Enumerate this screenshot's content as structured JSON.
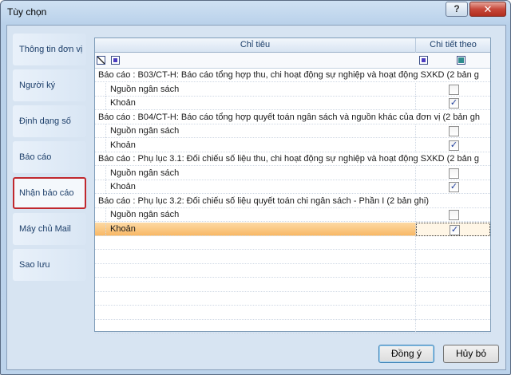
{
  "window": {
    "title": "Tùy chọn",
    "help_label": "?",
    "close_label": "✕"
  },
  "nav": {
    "items": [
      {
        "label": "Thông tin đơn vị"
      },
      {
        "label": "Người ký"
      },
      {
        "label": "Định dạng số"
      },
      {
        "label": "Báo cáo"
      },
      {
        "label": "Nhận báo cáo"
      },
      {
        "label": "Máy chủ Mail"
      },
      {
        "label": "Sao lưu"
      }
    ],
    "active": "Nhận báo cáo"
  },
  "grid": {
    "columns": [
      "Chỉ tiêu",
      "Chi tiết theo"
    ],
    "groups": [
      {
        "header": "Báo cáo : B03/CT-H: Báo cáo tổng hợp thu, chi hoạt động sự nghiệp và hoạt động SXKD (2 bản g",
        "rows": [
          {
            "label": "Nguồn ngân sách",
            "checked": false
          },
          {
            "label": "Khoản",
            "checked": true
          }
        ]
      },
      {
        "header": "Báo cáo : B04/CT-H: Báo cáo tổng hợp quyết toán ngân sách và nguồn khác của đơn vị (2 bản gh",
        "rows": [
          {
            "label": "Nguồn ngân sách",
            "checked": false
          },
          {
            "label": "Khoản",
            "checked": true
          }
        ]
      },
      {
        "header": "Báo cáo : Phụ lục 3.1: Đối chiếu số liệu thu, chi hoạt động sự nghiệp và hoạt động SXKD (2 bản g",
        "rows": [
          {
            "label": "Nguồn ngân sách",
            "checked": false
          },
          {
            "label": "Khoản",
            "checked": true
          }
        ]
      },
      {
        "header": "Báo cáo : Phụ lục 3.2: Đối chiếu số liệu quyết toán chi ngân sách - Phần I (2 bản ghi)",
        "rows": [
          {
            "label": "Nguồn ngân sách",
            "checked": false
          },
          {
            "label": "Khoản",
            "checked": true
          }
        ]
      }
    ],
    "check_glyph": "✓"
  },
  "buttons": {
    "ok_label": "Đồng ý",
    "cancel_label": "Hủy bỏ"
  }
}
